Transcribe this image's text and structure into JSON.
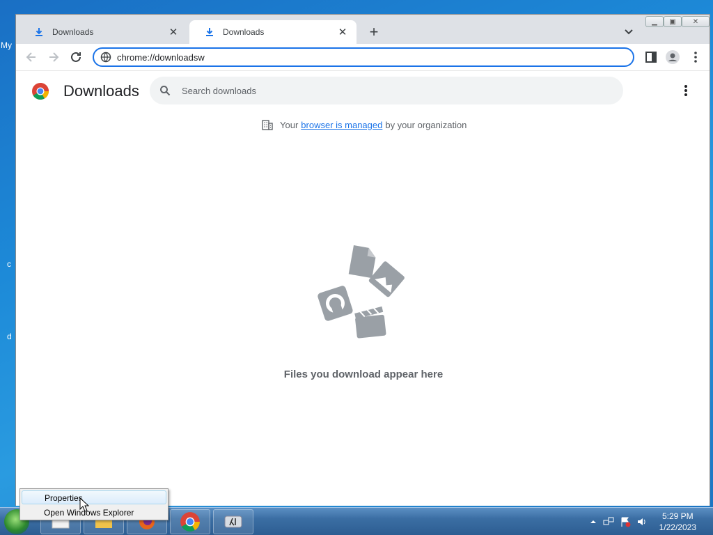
{
  "desktop": {
    "fragments": [
      "My",
      "c",
      "d"
    ]
  },
  "browser": {
    "tabs": [
      {
        "label": "Downloads",
        "active": false
      },
      {
        "label": "Downloads",
        "active": true
      }
    ],
    "new_tab_icon": "plus-icon",
    "omnibox": {
      "url": "chrome://downloadsw"
    },
    "accent_color": "#1a73e8"
  },
  "page": {
    "title": "Downloads",
    "search": {
      "placeholder": "Search downloads"
    },
    "managed": {
      "prefix": "Your",
      "link": "browser is managed",
      "suffix": "by your organization"
    },
    "empty_state": "Files you download appear here"
  },
  "context_menu": {
    "items": [
      {
        "label": "Properties",
        "highlighted": true
      },
      {
        "label": "Open Windows Explorer",
        "highlighted": false
      }
    ]
  },
  "taskbar": {
    "clock": {
      "time": "5:29 PM",
      "date": "1/22/2023"
    }
  }
}
